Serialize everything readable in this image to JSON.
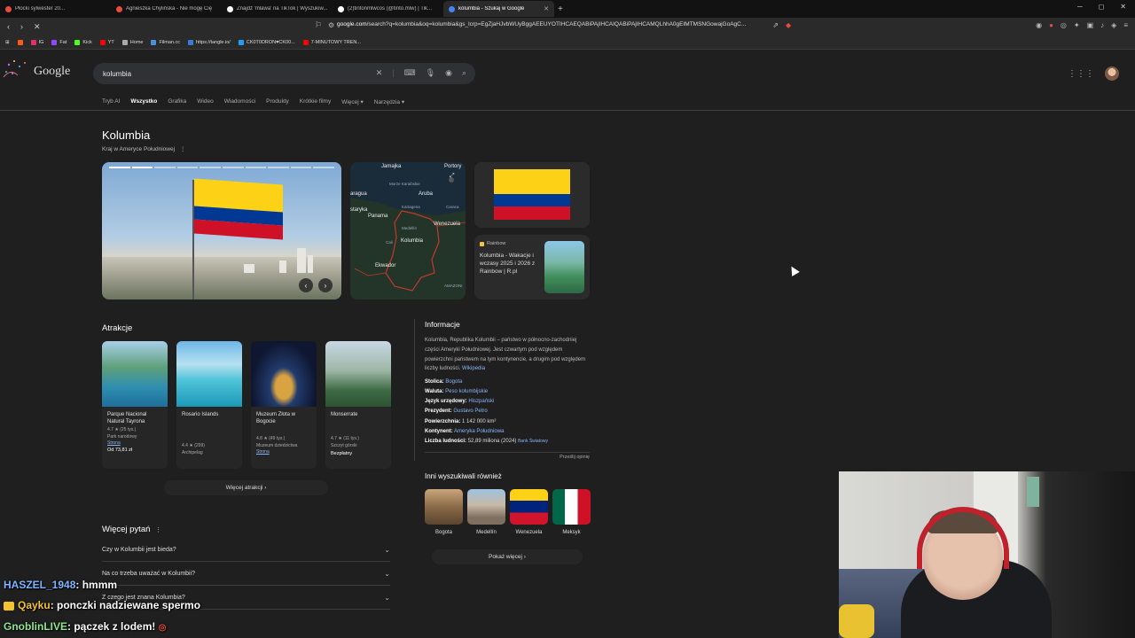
{
  "browser": {
    "tabs": [
      {
        "title": "Płocki sylwester 20...",
        "color": "#e74c3c"
      },
      {
        "title": "Agnieszka Chylińska - Nie mogę Cię",
        "color": "#e74c3c"
      },
      {
        "title": "Znajdź 'mlawa' na TikTok | Wyszukiw...",
        "color": "#ffffff"
      },
      {
        "title": "(2)tintonmlwcos (@tinto.mlw) | Tik...",
        "color": "#ffffff"
      },
      {
        "title": "kolumbia - Szukaj w Google",
        "color": "#ffffff",
        "active": true
      }
    ],
    "new_tab": "+",
    "url_host": "google.com",
    "url_rest": "/search?q=kolumbia&oq=kolumbia&gs_lcrp=EgZjaHJvbWUyBggAEEUYOTIHCAEQABiPAjIHCAIQABiPAjIHCAMQLhhA0gEIMTMSNGowajGoAgC...",
    "bookmarks": [
      {
        "label": "IG",
        "color": "#e1306c"
      },
      {
        "label": "Fat",
        "color": "#9146ff"
      },
      {
        "label": "Kick",
        "color": "#53fc18"
      },
      {
        "label": "YT",
        "color": "#ff0000"
      },
      {
        "label": "Home",
        "color": "#aaaaaa"
      },
      {
        "label": "Filman.cc",
        "color": "#4a90d9"
      },
      {
        "label": "https://tangle.io/",
        "color": "#3a7bd5"
      },
      {
        "label": "CK0T0DRON♥CK00...",
        "color": "#1da1f2"
      },
      {
        "label": "7-MINUTOWY TREN...",
        "color": "#ff0000"
      }
    ]
  },
  "google": {
    "logo": "Google",
    "query": "kolumbia",
    "tabs": [
      "Tryb AI",
      "Wszystko",
      "Grafika",
      "Wideo",
      "Wiadomości",
      "Produkty",
      "Krótkie filmy",
      "Więcej ▾",
      "Narzędzia ▾"
    ],
    "active_tab": "Wszystko"
  },
  "entity": {
    "title": "Kolumbia",
    "subtitle": "Kraj w Ameryce Południowej",
    "map_labels": [
      "Jamajka",
      "Portory",
      "Aruba",
      "Kartagena",
      "Caraca",
      "Panama",
      "Medellín",
      "Wenezuela",
      "Cali",
      "Kolumbia",
      "Ekwador",
      "Morze Karaibskie",
      "aragua",
      "starykа",
      "AMAZONI"
    ],
    "flag_colors": [
      "#fcd116",
      "#003893",
      "#ce1126"
    ],
    "rainbow": {
      "source": "Rainbow",
      "text": "Kolumbia - Wakacje i wczasy 2025 i 2026 z Rainbow | R.pl"
    }
  },
  "attractions": {
    "title": "Atrakcje",
    "items": [
      {
        "name": "Parque Nacional Natural Tayrona",
        "rating": "4.7 ★ (25 tys.)",
        "type": "Park narodowy",
        "link": "Strona",
        "extra": "Od 73,81 zł"
      },
      {
        "name": "Rosario Islands",
        "rating": "4.4 ★ (299)",
        "type": "Archipelag",
        "link": "",
        "extra": ""
      },
      {
        "name": "Muzeum Złota w Bogocie",
        "rating": "4.8 ★ (49 tys.)",
        "type": "Muzeum dziedzictwa",
        "link": "Strona",
        "extra": ""
      },
      {
        "name": "Monserrate",
        "rating": "4.7 ★ (11 tys.)",
        "type": "Szczyt górski",
        "link": "",
        "extra": "Bezpłatny"
      }
    ],
    "more": "Więcej atrakcji ›"
  },
  "faq": {
    "title": "Więcej pytań",
    "items": [
      "Czy w Kolumbii jest bieda?",
      "Na co trzeba uważać w Kolumbii?",
      "Z czego jest znana Kolumbia?"
    ]
  },
  "info": {
    "title": "Informacje",
    "description": "Kolumbia, Republika Kolumbii – państwo w północno-zachodniej części Ameryki Południowej. Jest czwartym pod względem powierzchni państwem na tym kontynencie, a drugim pod względem liczby ludności.",
    "source": "Wikipedia",
    "rows": [
      {
        "key": "Stolica:",
        "value": "Bogota"
      },
      {
        "key": "Waluta:",
        "value": "Peso kolumbijskie"
      },
      {
        "key": "Język urzędowy:",
        "value": "Hiszpański"
      },
      {
        "key": "Prezydent:",
        "value": "Gustavo Petro"
      },
      {
        "key": "Powierzchnia:",
        "value": "1 142 000 km²"
      },
      {
        "key": "Kontynent:",
        "value": "Ameryka Południowa"
      },
      {
        "key": "Liczba ludności:",
        "value": "52,89 miliona (2024)",
        "extra": "Bank Światowy"
      }
    ],
    "feedback": "Prześlij opinię"
  },
  "others": {
    "title": "Inni wyszukiwali również",
    "items": [
      "Bogota",
      "Medellín",
      "Wenezuela",
      "Meksyk"
    ],
    "more": "Pokaż więcej ›"
  },
  "chat": [
    {
      "user": "HASZEL_1948",
      "msg": ": hmmm"
    },
    {
      "user": "Qayku",
      "msg": ": ponczki nadziewane spermo"
    },
    {
      "user": "GnoblinLIVE",
      "msg": ": pączek z lodem!"
    }
  ]
}
